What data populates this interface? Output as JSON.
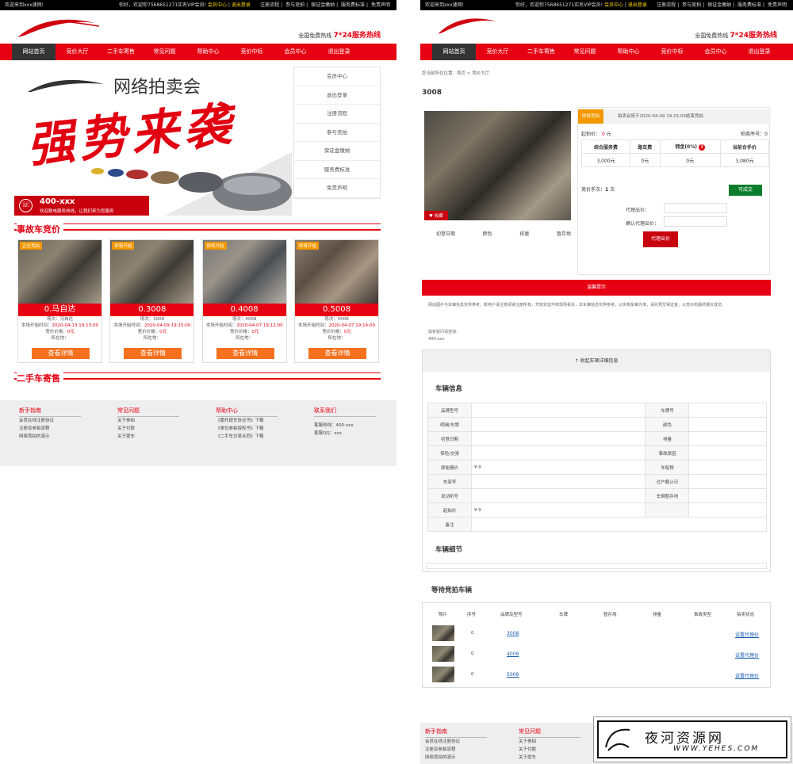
{
  "top": {
    "welcome": "欢迎来到xxx速网!",
    "greet_left": "你好，欢迎你7568651271实名VIP会员!",
    "greet_right": "你好，欢迎你7568651271实名VIP会员!",
    "member_center": "会员中心",
    "logout": "退出登录",
    "links": [
      "注册流程",
      "参与竞拍",
      "保证金缴纳",
      "服务费标准",
      "免责声明"
    ]
  },
  "header": {
    "hotline_label": "全国免费热线",
    "hotline_value": "7*24服务热线"
  },
  "nav": [
    "网站首页",
    "竞价大厅",
    "二手车寄售",
    "常见问题",
    "帮助中心",
    "竞价中标",
    "会员中心",
    "退出登录"
  ],
  "hero": {
    "title": "网络拍卖会",
    "slogan": "强势来袭",
    "phone": "400-xxx",
    "phone_sub": "欢迎致电服务热线，让我们来为您服务"
  },
  "side_menu": [
    "会员中心",
    "退出登录",
    "注册流程",
    "参与竞拍",
    "保证金缴纳",
    "服务费标准",
    "免责声明"
  ],
  "sections": {
    "accident": "事故车竞价",
    "used": "二手车寄售"
  },
  "cards": [
    {
      "tag": "正在竞拍",
      "name": "0.马自达",
      "field1": "场次：马自达",
      "field2_label": "本场开始时间：",
      "field2_value": "2020-04-13 19:13:00",
      "field3_label": "竞价价格：",
      "field3_value": "0元",
      "field4": "所在地：",
      "button": "查看详情"
    },
    {
      "tag": "即将开始",
      "name": "0.3008",
      "field1": "场次：3008",
      "field2_label": "本场开始时间：",
      "field2_value": "2020-04-09 19:15:00",
      "field3_label": "竞价价格：",
      "field3_value": "0元",
      "field4": "所在地：",
      "button": "查看详情"
    },
    {
      "tag": "即将开始",
      "name": "0.4008",
      "field1": "场次：4008",
      "field2_label": "本场开始时间：",
      "field2_value": "2020-04-07 19:12:00",
      "field3_label": "竞价价格：",
      "field3_value": "0元",
      "field4": "所在地：",
      "button": "查看详情"
    },
    {
      "tag": "即将开始",
      "name": "0.5008",
      "field1": "场次：5008",
      "field2_label": "本场开始时间：",
      "field2_value": "2020-04-07 19:14:00",
      "field3_label": "竞价价格：",
      "field3_value": "0元",
      "field4": "所在地：",
      "button": "查看详情"
    }
  ],
  "footer": {
    "cols": [
      {
        "title": "新手指南",
        "links": [
          "会员在线注册协议",
          "注册及参拍流程",
          "网络竞拍的演示"
        ]
      },
      {
        "title": "常见问题",
        "links": [
          "关于参拍",
          "关于付款",
          "关于提车"
        ]
      },
      {
        "title": "帮助中心",
        "links": [
          "《委托提车协议书》下载",
          "《单位参拍授权书》下载",
          "《二手车交易合同》下载"
        ]
      },
      {
        "title": "联系我们",
        "links": [
          "客服热线：400-xxx",
          "客服QQ：xxx"
        ]
      }
    ]
  },
  "detail": {
    "breadcrumb": "您当前所在位置：首页 > 竞价大厅",
    "title": "3008",
    "favorite": "收藏",
    "specs": [
      "初登日期",
      "颜色",
      "排量",
      "暂存地"
    ],
    "status_label": "即将竞拍",
    "status_text": "拍卖会将于2020-04-09 19:15:00结束竞拍",
    "start_price_label": "起拍价：",
    "start_price_value": "0",
    "start_price_unit": "元",
    "lot_no": "拍卖序号：0",
    "fee_headers": [
      "综合服务费",
      "路车费",
      "佣金(0%)",
      "当前合手价"
    ],
    "fee_values": [
      "3,000元",
      "0元",
      "0元",
      "3,080元"
    ],
    "bid_count_label": "竞价手次：",
    "bid_count_value": "1",
    "bid_count_unit": "次",
    "deal": "可成交",
    "proxy_label": "代理出价：",
    "confirm_label": "确认代理出价：",
    "proxy_button": "代理出价",
    "notice_bar": "温馨提示",
    "notice_text": "网站图片与车辆信息仅供参考，新用户请注意阅读注册所有，凭有效证件到现场看车，本车辆信息仅供参考，以实物车辆为准，请先预交保证金，以竞价的最终报价成交。",
    "consult_label": "如有疑问请咨询：",
    "consult_value": "400-xxx",
    "collapse": "收起车辆详细信息",
    "vehicle_info": "车辆信息",
    "vehicle_rows": [
      [
        "品牌型号",
        "",
        "车牌号",
        ""
      ],
      [
        "明细/车牌",
        "",
        "颜色",
        ""
      ],
      [
        "初登日期",
        "",
        "排量",
        ""
      ],
      [
        "保险/交强",
        "",
        "事故原因",
        ""
      ],
      [
        "原始报价",
        "¥ 0",
        "车船税",
        ""
      ],
      [
        "车架号",
        "",
        "过户截止日",
        ""
      ],
      [
        "发动机号",
        "",
        "车辆暂存地",
        ""
      ],
      [
        "起拍价",
        "¥ 0",
        "",
        ""
      ],
      [
        "备注",
        "",
        "",
        ""
      ]
    ],
    "vehicle_detail": "车辆细节"
  },
  "waiting": {
    "title": "等待竞拍车辆",
    "headers": [
      "照片",
      "序号",
      "品牌及型号",
      "车牌",
      "暂存场",
      "排量",
      "事故类型",
      "拍卖状态"
    ],
    "rows": [
      {
        "no": "0",
        "model": "3008",
        "action": "设置代理价"
      },
      {
        "no": "0",
        "model": "4008",
        "action": "设置代理价"
      },
      {
        "no": "0",
        "model": "5008",
        "action": "设置代理价"
      }
    ]
  },
  "watermark": {
    "cn": "夜河资源网",
    "url": "WWW.YEHES.COM"
  },
  "colors": {
    "brand_red": "#e60012",
    "orange": "#f5711e",
    "green": "#0b7d2b",
    "dark": "#000000"
  }
}
